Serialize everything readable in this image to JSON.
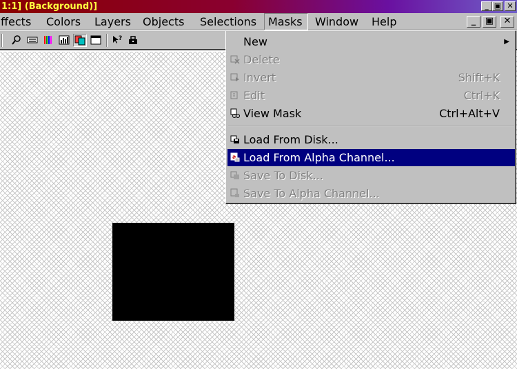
{
  "window": {
    "title": "1:1] (Background)]",
    "buttons": [
      "_",
      "▣",
      "✕"
    ]
  },
  "menubar": {
    "items": [
      {
        "label": "ffects"
      },
      {
        "label": "Colors"
      },
      {
        "label": "Layers"
      },
      {
        "label": "Objects"
      },
      {
        "label": "Selections"
      },
      {
        "label": "Masks"
      },
      {
        "label": "Window"
      },
      {
        "label": "Help"
      }
    ],
    "mdi_buttons": [
      "_",
      "▣",
      "✕"
    ]
  },
  "toolbar": {
    "icons": [
      "magnifier-icon",
      "keyboard-icon",
      "color-bars-icon",
      "histogram-icon",
      "layers-icon",
      "window-icon",
      "help-pointer-icon",
      "toolbox-icon"
    ]
  },
  "masks_menu": {
    "items": [
      {
        "label": "New",
        "shortcut": "",
        "submenu_arrow": "▶",
        "state": "enabled"
      },
      {
        "label": "Delete",
        "shortcut": "",
        "state": "disabled"
      },
      {
        "label": "Invert",
        "shortcut": "Shift+K",
        "state": "disabled"
      },
      {
        "label": "Edit",
        "shortcut": "Ctrl+K",
        "state": "disabled"
      },
      {
        "label": "View Mask",
        "shortcut": "Ctrl+Alt+V",
        "state": "enabled"
      },
      {
        "label": "Load From Disk...",
        "shortcut": "",
        "state": "enabled"
      },
      {
        "label": "Load From Alpha Channel...",
        "shortcut": "",
        "state": "selected"
      },
      {
        "label": "Save To Disk...",
        "shortcut": "",
        "state": "disabled"
      },
      {
        "label": "Save To Alpha Channel...",
        "shortcut": "",
        "state": "disabled"
      }
    ]
  },
  "colors": {
    "selection_highlight": "#000080",
    "menu_face": "#c0c0c0",
    "title_text": "#ffff40"
  }
}
